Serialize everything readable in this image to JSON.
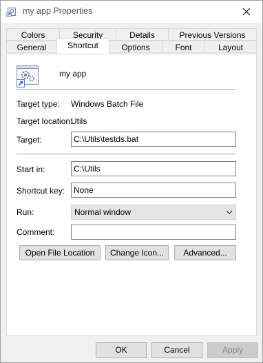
{
  "window": {
    "title": "my app Properties"
  },
  "tabs": {
    "row1": [
      "Colors",
      "Security",
      "Details",
      "Previous Versions"
    ],
    "row2": [
      "General",
      "Shortcut",
      "Options",
      "Font",
      "Layout"
    ]
  },
  "shortcut": {
    "app_name": "my app",
    "target_type_label": "Target type:",
    "target_type_value": "Windows Batch File",
    "target_location_label": "Target location:",
    "target_location_value": "Utils",
    "target_label": "Target:",
    "target_value": "C:\\Utils\\testds.bat",
    "start_in_label": "Start in:",
    "start_in_value": "C:\\Utils",
    "shortcut_key_label": "Shortcut key:",
    "shortcut_key_value": "None",
    "run_label": "Run:",
    "run_value": "Normal window",
    "comment_label": "Comment:",
    "comment_value": "",
    "open_file_location": "Open File Location",
    "change_icon": "Change Icon...",
    "advanced": "Advanced..."
  },
  "footer": {
    "ok": "OK",
    "cancel": "Cancel",
    "apply": "Apply"
  }
}
